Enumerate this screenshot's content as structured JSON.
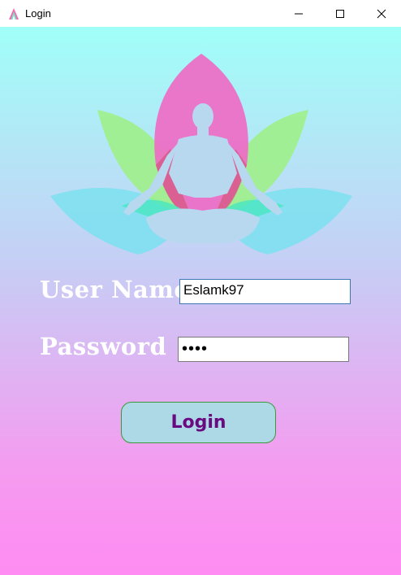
{
  "window": {
    "title": "Login",
    "icon": "app-logo-icon",
    "controls": [
      "minimize-icon",
      "maximize-icon",
      "close-icon"
    ]
  },
  "illustration": {
    "icon": "lotus-meditation-icon",
    "colors": {
      "pink": "#ee6bc4",
      "green": "#9ef08a",
      "teal": "#48e6c0",
      "blue": "#80e0f0",
      "figure": "#b8d8f0"
    }
  },
  "form": {
    "username_label": "User Name",
    "username_value": "Eslamk97",
    "password_label": "Password",
    "password_value": "••••",
    "login_label": "Login"
  },
  "colors": {
    "gradient_top": "#a0fff8",
    "gradient_bottom": "#ff8cf2",
    "button_bg": "#add8e6",
    "button_text": "#6a0a80",
    "button_border": "#3a9a3a"
  }
}
